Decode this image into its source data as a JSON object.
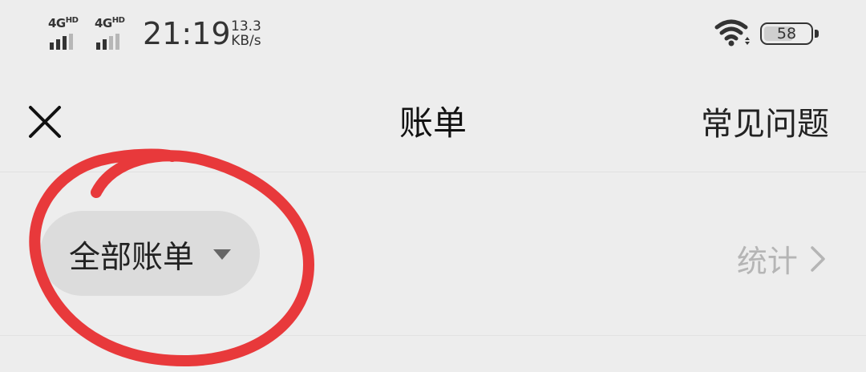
{
  "status_bar": {
    "network_1": "4G",
    "network_1_sup": "HD",
    "network_2": "4G",
    "network_2_sup": "HD",
    "time": "21:19",
    "speed_value": "13.3",
    "speed_unit": "KB/s",
    "battery_level": "58"
  },
  "navbar": {
    "close_icon": "close-icon",
    "title": "账单",
    "faq_label": "常见问题"
  },
  "filter": {
    "selected": "全部账单",
    "dropdown_icon": "caret-down-icon",
    "stats_label": "统计",
    "stats_icon": "chevron-right-icon"
  },
  "colors": {
    "background": "#ededed",
    "pill": "#dcdcdc",
    "annotation_red": "#e8393b",
    "muted_text": "#b5b5b5"
  }
}
